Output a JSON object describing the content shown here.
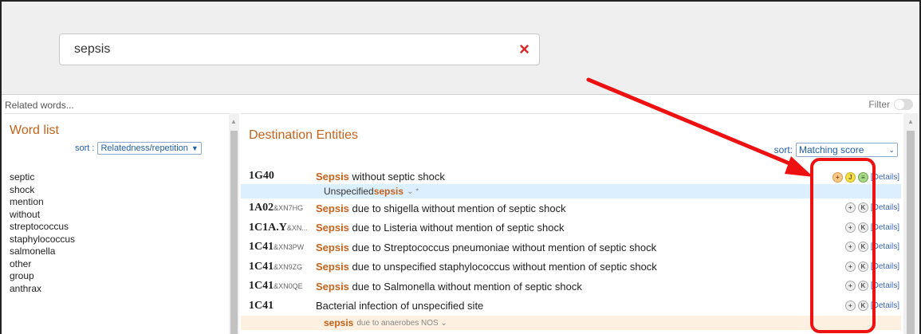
{
  "search": {
    "value": "sepsis",
    "clear_icon": "×"
  },
  "related_words_label": "Related words...",
  "filter_label": "Filter",
  "word_list": {
    "title": "Word list",
    "sort_label": "sort :",
    "sort_value": "Relatedness/repetition",
    "words": [
      "septic",
      "shock",
      "mention",
      "without",
      "streptococcus",
      "staphylococcus",
      "salmonella",
      "other",
      "group",
      "anthrax"
    ]
  },
  "destination": {
    "title": "Destination Entities",
    "sort_label": "sort:",
    "sort_value": "Matching score",
    "details_label": "[Details]",
    "rows": [
      {
        "code": "1G40",
        "suffix": "",
        "keyword": "Sepsis",
        "rest": " without septic shock",
        "badges": [
          "+",
          "J",
          "≡"
        ]
      },
      {
        "code": "1A02",
        "suffix": "&XN7HG",
        "keyword": "Sepsis",
        "rest": " due to shigella without mention of septic shock",
        "badges": [
          "+",
          "K"
        ]
      },
      {
        "code": "1C1A.Y",
        "suffix": "&XN...",
        "keyword": "Sepsis",
        "rest": " due to Listeria without mention of septic shock",
        "badges": [
          "+",
          "K"
        ]
      },
      {
        "code": "1C41",
        "suffix": "&XN3PW",
        "keyword": "Sepsis",
        "rest": " due to Streptococcus pneumoniae without mention of septic shock",
        "badges": [
          "+",
          "K"
        ]
      },
      {
        "code": "1C41",
        "suffix": "&XN9ZG",
        "keyword": "Sepsis",
        "rest": " due to unspecified staphylococcus without mention of septic shock",
        "badges": [
          "+",
          "K"
        ]
      },
      {
        "code": "1C41",
        "suffix": "&XN0QE",
        "keyword": "Sepsis",
        "rest": " due to Salmonella without mention of septic shock",
        "badges": [
          "+",
          "K"
        ]
      },
      {
        "code": "1C41",
        "suffix": "",
        "keyword": "",
        "rest": "Bacterial infection of unspecified site",
        "badges": [
          "+",
          "K"
        ]
      }
    ],
    "sub_rows": {
      "first": {
        "prefix": "Unspecified ",
        "keyword": "sepsis",
        "suffix": " ⌄ *"
      },
      "last": {
        "prefix": "",
        "keyword": "sepsis",
        "suffix": " due to anaerobes NOS ⌄"
      }
    }
  },
  "annotation": {
    "arrow_color": "#ee1111",
    "box_color": "#ee1111"
  }
}
